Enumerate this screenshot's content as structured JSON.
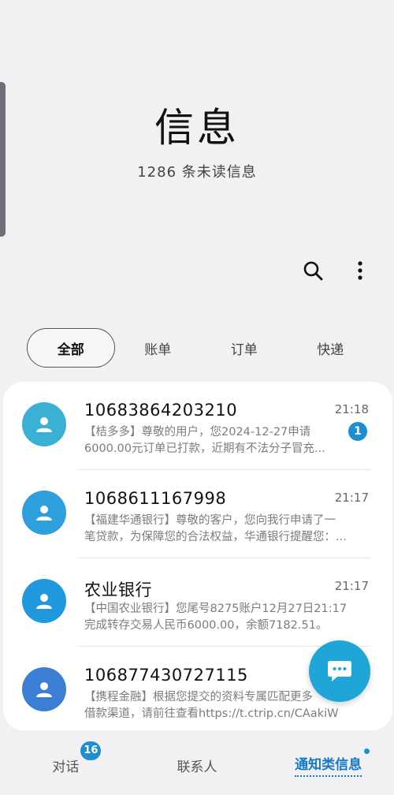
{
  "header": {
    "title": "信息",
    "subtitle": "1286 条未读信息"
  },
  "actions": {
    "search_icon": "search-icon",
    "more_icon": "more-vert-icon"
  },
  "tabs": [
    {
      "label": "全部",
      "active": true
    },
    {
      "label": "账单",
      "active": false
    },
    {
      "label": "订单",
      "active": false
    },
    {
      "label": "快递",
      "active": false
    }
  ],
  "messages": [
    {
      "sender": "10683864203210",
      "time": "21:18",
      "preview_line1": "【桔多多】尊敬的用户，您2024-12-27申请",
      "preview_line2": "6000.00元订单已打款，近期有不法分子冒充...",
      "unread": "1",
      "avatar_color": "#3ab0d4"
    },
    {
      "sender": "1068611167998",
      "time": "21:17",
      "preview_line1": "【福建华通银行】尊敬的客户，您向我行申请了一",
      "preview_line2": "笔贷款，为保障您的合法权益，华通银行提醒您：...",
      "unread": "",
      "avatar_color": "#2d9fdc"
    },
    {
      "sender": "农业银行",
      "time": "21:17",
      "preview_line1": "【中国农业银行】您尾号8275账户12月27日21:17",
      "preview_line2": "完成转存交易人民币6000.00，余额7182.51。",
      "unread": "",
      "avatar_color": "#1f98dd"
    },
    {
      "sender": "106877430727115",
      "time": "",
      "preview_line1": "【携程金融】根据您提交的资料专属匹配更多",
      "preview_line2": "借款渠道，请前往查看https://t.ctrip.cn/CAakiW",
      "unread": "",
      "avatar_color": "#3a7fd3"
    }
  ],
  "fab": {
    "icon": "chat-bubble-icon"
  },
  "bottom_nav": [
    {
      "label": "对话",
      "badge": "16",
      "active": false
    },
    {
      "label": "联系人",
      "badge": "",
      "active": false
    },
    {
      "label": "通知类信息",
      "badge": "",
      "active": true
    }
  ],
  "colors": {
    "accent": "#1479c9",
    "badge": "#1d8fd1",
    "fab": "#1ea6d6"
  }
}
